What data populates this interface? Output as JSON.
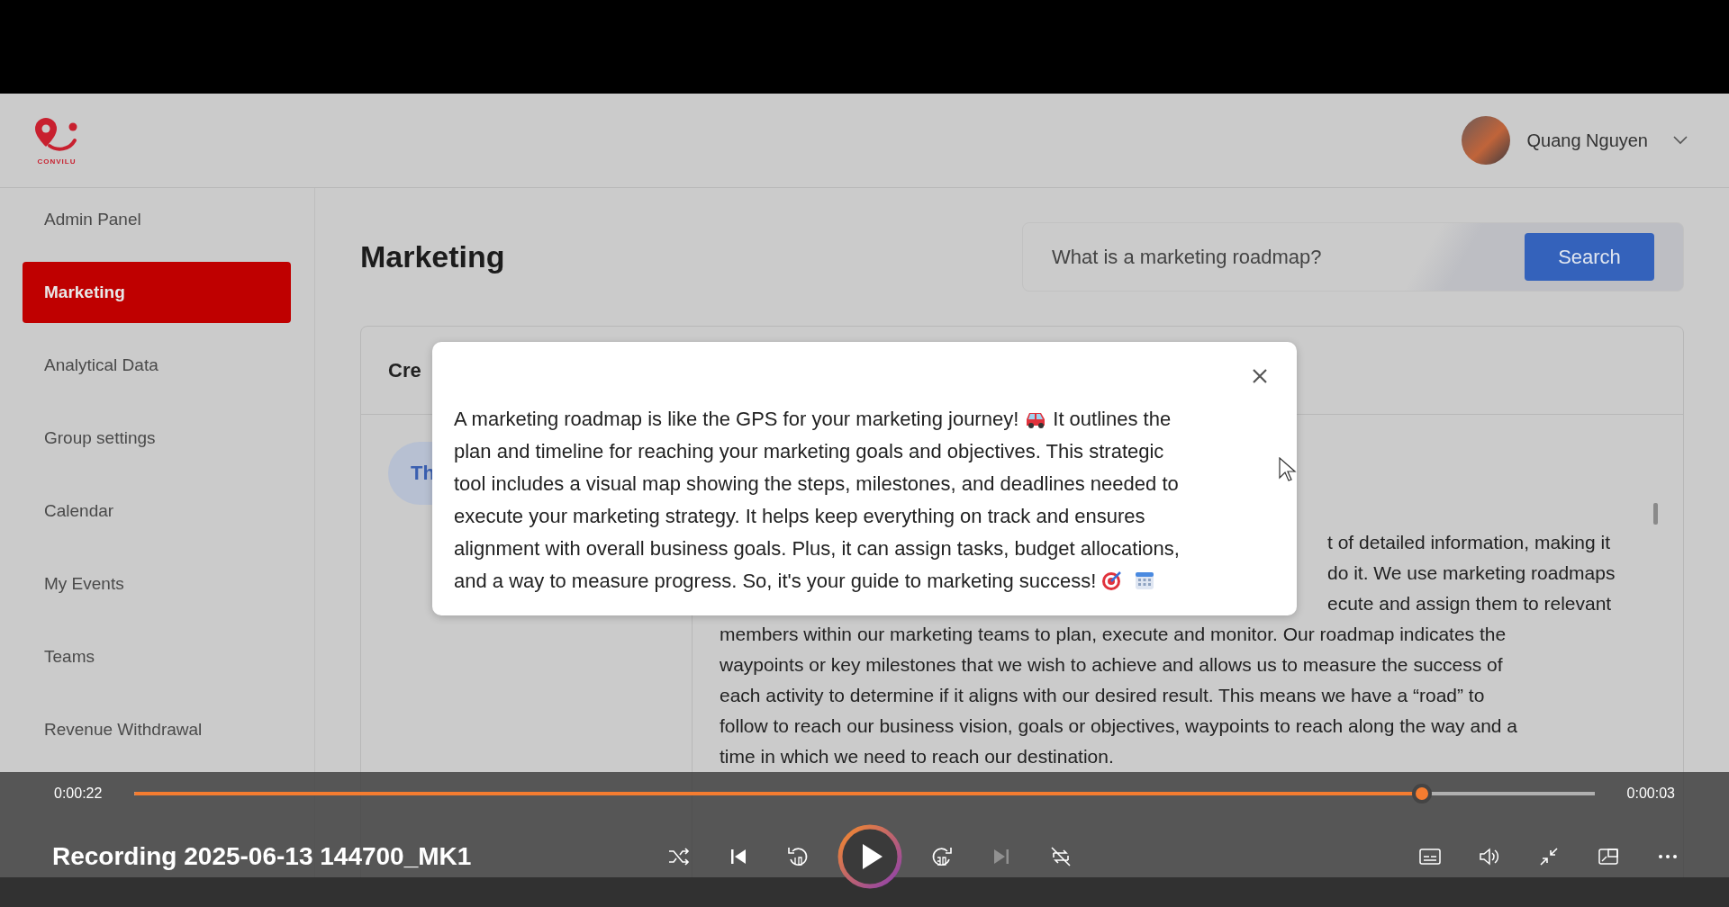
{
  "header": {
    "logo_text": "CONVILU",
    "user_name": "Quang Nguyen"
  },
  "sidebar": {
    "items": [
      {
        "label": "Admin Panel",
        "selected": false
      },
      {
        "label": "Marketing",
        "selected": true
      },
      {
        "label": "Analytical Data",
        "selected": false
      },
      {
        "label": "Group settings",
        "selected": false
      },
      {
        "label": "Calendar",
        "selected": false
      },
      {
        "label": "My Events",
        "selected": false
      },
      {
        "label": "Teams",
        "selected": false
      },
      {
        "label": "Revenue Withdrawal",
        "selected": false
      }
    ]
  },
  "page": {
    "title": "Marketing",
    "search": {
      "value": "What is a marketing roadmap?",
      "button": "Search"
    }
  },
  "card": {
    "header": "Cre",
    "pill": "Th",
    "paragraphs": [
      {
        "lines": [
          {
            "text": "t of detailed information, making it",
            "partly_covered": true
          },
          {
            "text": "do it. We use marketing roadmaps",
            "partly_covered": true
          },
          {
            "text": "ecute and assign them to relevant",
            "partly_covered": true
          },
          {
            "text": "members within our marketing teams to plan, execute and monitor. Our roadmap indicates the",
            "partly_covered": false
          },
          {
            "text": "waypoints or key milestones that we wish to achieve and allows us to measure the success of",
            "partly_covered": false
          },
          {
            "text": "each activity to determine if it aligns with our desired result. This means we have a “road” to",
            "partly_covered": false
          },
          {
            "text": "follow to reach our business vision, goals or objectives, waypoints to reach along the way and a",
            "partly_covered": false
          },
          {
            "text": "time in which we need to reach our destination.",
            "partly_covered": false
          }
        ]
      }
    ]
  },
  "modal": {
    "lines": [
      [
        {
          "kind": "text",
          "text": "A marketing roadmap is like the GPS for your marketing journey!"
        },
        {
          "kind": "car"
        },
        {
          "kind": "text",
          "text": "It outlines the"
        }
      ],
      [
        {
          "kind": "text",
          "text": "plan and timeline for reaching your marketing goals and objectives. This strategic"
        }
      ],
      [
        {
          "kind": "text",
          "text": "tool includes a visual map showing the steps, milestones, and deadlines needed to"
        }
      ],
      [
        {
          "kind": "text",
          "text": "execute your marketing strategy. It helps keep everything on track and ensures"
        }
      ],
      [
        {
          "kind": "text",
          "text": "alignment with overall business goals. Plus, it can assign tasks, budget allocations,"
        }
      ],
      [
        {
          "kind": "text",
          "text": "and a way to measure progress. So, it's your guide to marketing success!"
        },
        {
          "kind": "target"
        },
        {
          "kind": "calendar"
        }
      ]
    ]
  },
  "player": {
    "elapsed": "0:00:22",
    "remaining": "0:00:03",
    "level": 0.882,
    "title": "Recording 2025-06-13 144700_MK1",
    "center_controls": [
      {
        "kind": "shuffle",
        "disabled": false
      },
      {
        "kind": "previous",
        "disabled": false
      },
      {
        "kind": "back10",
        "disabled": false
      },
      {
        "kind": "play",
        "disabled": false
      },
      {
        "kind": "forward30",
        "disabled": false
      },
      {
        "kind": "next",
        "disabled": true
      },
      {
        "kind": "repeat",
        "disabled": false
      }
    ],
    "right_controls": [
      {
        "kind": "subtitles",
        "disabled": false
      },
      {
        "kind": "volume",
        "disabled": false
      },
      {
        "kind": "minimize",
        "disabled": false
      },
      {
        "kind": "miniplayer",
        "disabled": false
      },
      {
        "kind": "more",
        "disabled": false
      }
    ]
  }
}
